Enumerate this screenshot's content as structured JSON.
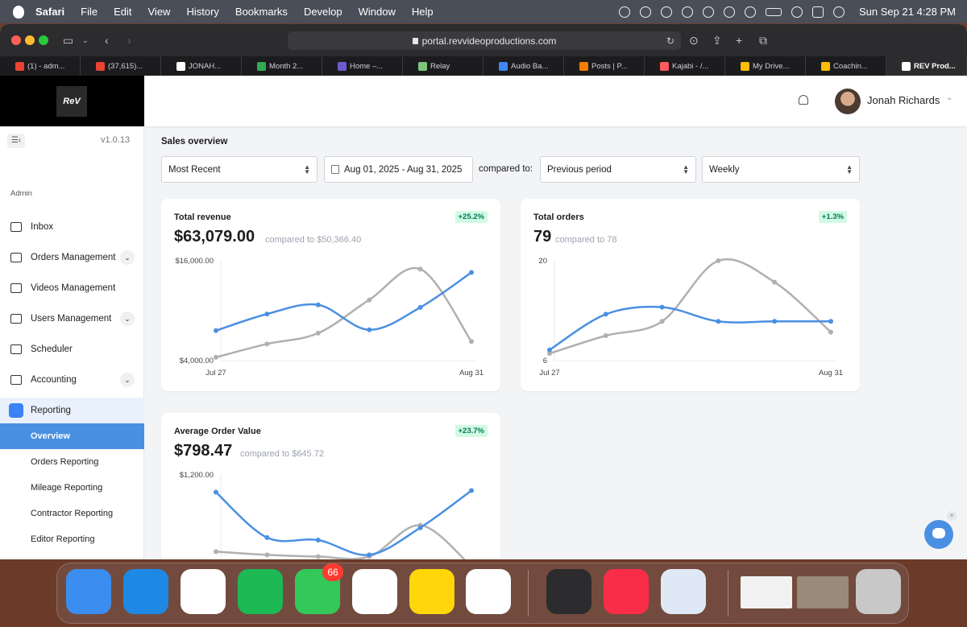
{
  "menubar": {
    "items": [
      "Safari",
      "File",
      "Edit",
      "View",
      "History",
      "Bookmarks",
      "Develop",
      "Window",
      "Help"
    ],
    "clock": "Sun Sep 21  4:28 PM"
  },
  "browser": {
    "url": "portal.revvideoproductions.com",
    "tabs": [
      {
        "label": "(1) - adm...",
        "color": "#ea4335"
      },
      {
        "label": "(37,615)...",
        "color": "#ea4335"
      },
      {
        "label": "JONAH...",
        "color": "#ffffff"
      },
      {
        "label": "Month 2...",
        "color": "#34a853"
      },
      {
        "label": "Home –...",
        "color": "#6d5bd0"
      },
      {
        "label": "Relay",
        "color": "#7bc67b"
      },
      {
        "label": "Audio Ba...",
        "color": "#4285f4"
      },
      {
        "label": "Posts | P...",
        "color": "#f57c00"
      },
      {
        "label": "Kajabi - /...",
        "color": "#ff5a5f"
      },
      {
        "label": "My Drive...",
        "color": "#fbbc04"
      },
      {
        "label": "Coachin...",
        "color": "#fbbc04"
      },
      {
        "label": "REV Prod...",
        "color": "#ffffff"
      }
    ]
  },
  "header": {
    "logo_text": "ReV",
    "user_name": "Jonah Richards"
  },
  "sidebar": {
    "version": "v1.0.13",
    "section_label": "Admin",
    "items": [
      {
        "label": "Inbox",
        "icon": "mail-icon",
        "has_chevron": false
      },
      {
        "label": "Orders Management",
        "icon": "orders-icon",
        "has_chevron": true
      },
      {
        "label": "Videos Management",
        "icon": "video-icon",
        "has_chevron": false
      },
      {
        "label": "Users Management",
        "icon": "users-icon",
        "has_chevron": true
      },
      {
        "label": "Scheduler",
        "icon": "calendar-icon",
        "has_chevron": false
      },
      {
        "label": "Accounting",
        "icon": "wallet-icon",
        "has_chevron": true
      },
      {
        "label": "Reporting",
        "icon": "chart-icon",
        "has_chevron": false
      }
    ],
    "reporting_sub": [
      "Overview",
      "Orders Reporting",
      "Mileage Reporting",
      "Contractor Reporting",
      "Editor Reporting"
    ]
  },
  "main": {
    "title": "Sales overview",
    "filter_range": "Most Recent",
    "date_range": "Aug 01, 2025 - Aug 31, 2025",
    "compared_label": "compared to:",
    "compare_mode": "Previous period",
    "granularity": "Weekly"
  },
  "cards": {
    "revenue": {
      "title": "Total revenue",
      "badge": "+25.2%",
      "value": "$63,079.00",
      "compare": "compared to $50,366.40"
    },
    "orders": {
      "title": "Total orders",
      "badge": "+1.3%",
      "value": "79",
      "compare": "compared to 78"
    },
    "aov": {
      "title": "Average Order Value",
      "badge": "+23.7%",
      "value": "$798.47",
      "compare": "compared to $645.72"
    }
  },
  "chart_data": [
    {
      "type": "line",
      "ylim": [
        4000,
        16000
      ],
      "tick_labels_y": [
        "$16,000.00",
        "$4,000.00"
      ],
      "x_labels": [
        "Jul 27",
        "Aug 31"
      ],
      "series": [
        {
          "values": [
            7600,
            9600,
            10700,
            7700,
            10400,
            14600
          ],
          "color": "#4a90e2"
        },
        {
          "values": [
            4400,
            6000,
            7300,
            11300,
            15000,
            6300
          ],
          "color": "#b0b0b0"
        }
      ]
    },
    {
      "type": "line",
      "ylim": [
        6,
        20
      ],
      "tick_labels_y": [
        "20",
        "6"
      ],
      "x_labels": [
        "Jul 27",
        "Aug 31"
      ],
      "series": [
        {
          "values": [
            7.5,
            12.5,
            13.5,
            11.5,
            11.5,
            11.5
          ],
          "color": "#4a90e2"
        },
        {
          "values": [
            7,
            9.5,
            11.5,
            20,
            17,
            10
          ],
          "color": "#b0b0b0"
        }
      ]
    },
    {
      "type": "line",
      "ylim": [
        0,
        1200
      ],
      "tick_labels_y": [
        "$1,200.00"
      ],
      "x_labels": [],
      "series": [
        {
          "values": [
            990,
            440,
            410,
            230,
            560,
            1010
          ],
          "color": "#4a90e2"
        },
        {
          "values": [
            270,
            230,
            210,
            210,
            590,
            90
          ],
          "color": "#b0b0b0"
        }
      ]
    }
  ],
  "dock": {
    "apps": [
      {
        "name": "finder-icon",
        "color": "#3b8df0"
      },
      {
        "name": "safari-icon",
        "color": "#1e88e5"
      },
      {
        "name": "slack-icon",
        "color": "#ffffff"
      },
      {
        "name": "spotify-icon",
        "color": "#1db954"
      },
      {
        "name": "messages-icon",
        "color": "#34c759"
      },
      {
        "name": "chatgpt-icon",
        "color": "#ffffff"
      },
      {
        "name": "notes-icon",
        "color": "#ffd60a"
      },
      {
        "name": "chrome-icon",
        "color": "#ffffff"
      },
      {
        "name": "quicktime-icon",
        "color": "#2c2c2e"
      },
      {
        "name": "music-icon",
        "color": "#fa2d48"
      },
      {
        "name": "preview-icon",
        "color": "#dfe9f5"
      },
      {
        "name": "window-thumbnail-1",
        "color": "#f2f2f2"
      },
      {
        "name": "window-thumbnail-2",
        "color": "#9a8a7a"
      },
      {
        "name": "trash-icon",
        "color": "#c8c8c8"
      }
    ],
    "messages_badge": "66"
  }
}
